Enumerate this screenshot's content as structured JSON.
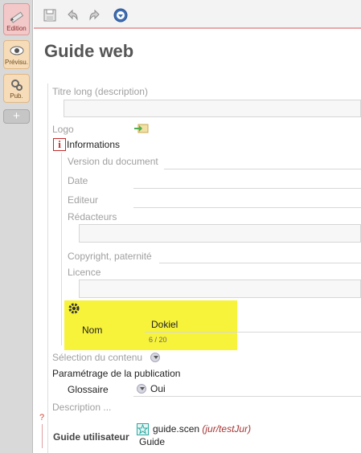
{
  "leftbar": {
    "tabs": [
      {
        "label": "Edition"
      },
      {
        "label": "Prévisu."
      },
      {
        "label": "Pub."
      },
      {
        "label": "+"
      }
    ]
  },
  "toolbar": {
    "save_icon": "floppy-disk-icon",
    "undo_icon": "undo-arrow-icon",
    "redo_icon": "redo-arrow-icon",
    "menu_icon": "down-circle-icon"
  },
  "page": {
    "title": "Guide web"
  },
  "fields": {
    "titre_long": "Titre long (description)",
    "logo": "Logo",
    "informations": "Informations",
    "version": "Version du document",
    "date": "Date",
    "editeur": "Editeur",
    "redacteurs": "Rédacteurs",
    "copyright": "Copyright, paternité",
    "licence": "Licence",
    "nom_label": "Nom",
    "nom_value": "Dokiel",
    "nom_count": "6 / 20",
    "selection": "Sélection du contenu",
    "parametrage": "Paramétrage de la publication",
    "glossaire_label": "Glossaire",
    "glossaire_value": "Oui",
    "description": "Description ...",
    "guide_utilisateur": "Guide utilisateur",
    "guide_file": "guide.scen",
    "guide_path": "(jur/testJur)",
    "guide_title": "Guide",
    "question_mark": "?"
  },
  "colors": {
    "highlight": "#f7f23a",
    "accent_red": "#c42b2b"
  }
}
